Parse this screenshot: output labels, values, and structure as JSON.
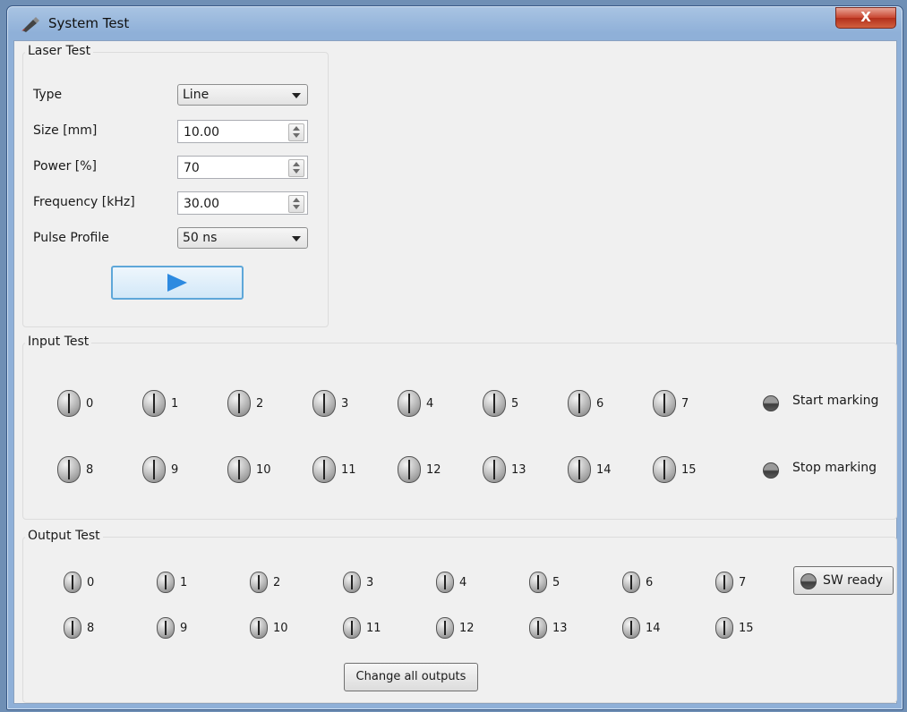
{
  "window": {
    "title": "System Test",
    "close_label": "X"
  },
  "laser_test": {
    "title": "Laser Test",
    "fields": [
      {
        "label": "Type",
        "kind": "combo",
        "value": "Line"
      },
      {
        "label": "Size [mm]",
        "kind": "spin",
        "value": "10.00"
      },
      {
        "label": "Power [%]",
        "kind": "spin",
        "value": "70"
      },
      {
        "label": "Frequency [kHz]",
        "kind": "spin",
        "value": "30.00"
      },
      {
        "label": "Pulse Profile",
        "kind": "combo",
        "value": "50 ns"
      }
    ],
    "play_icon": "play-icon"
  },
  "input_test": {
    "title": "Input Test",
    "row1": [
      "0",
      "1",
      "2",
      "3",
      "4",
      "5",
      "6",
      "7"
    ],
    "row2": [
      "8",
      "9",
      "10",
      "11",
      "12",
      "13",
      "14",
      "15"
    ],
    "indicators": [
      {
        "label": "Start marking",
        "icon": "led-indicator-icon"
      },
      {
        "label": "Stop marking",
        "icon": "led-indicator-icon"
      }
    ]
  },
  "output_test": {
    "title": "Output Test",
    "row1": [
      "0",
      "1",
      "2",
      "3",
      "4",
      "5",
      "6",
      "7"
    ],
    "row2": [
      "8",
      "9",
      "10",
      "11",
      "12",
      "13",
      "14",
      "15"
    ],
    "sw_ready_label": "SW ready",
    "change_all_label": "Change all outputs"
  },
  "colors": {
    "accent": "#2d8ae0",
    "close": "#c8452f",
    "title_frame": "#8fb0d8",
    "panel": "#f0f0f0"
  }
}
